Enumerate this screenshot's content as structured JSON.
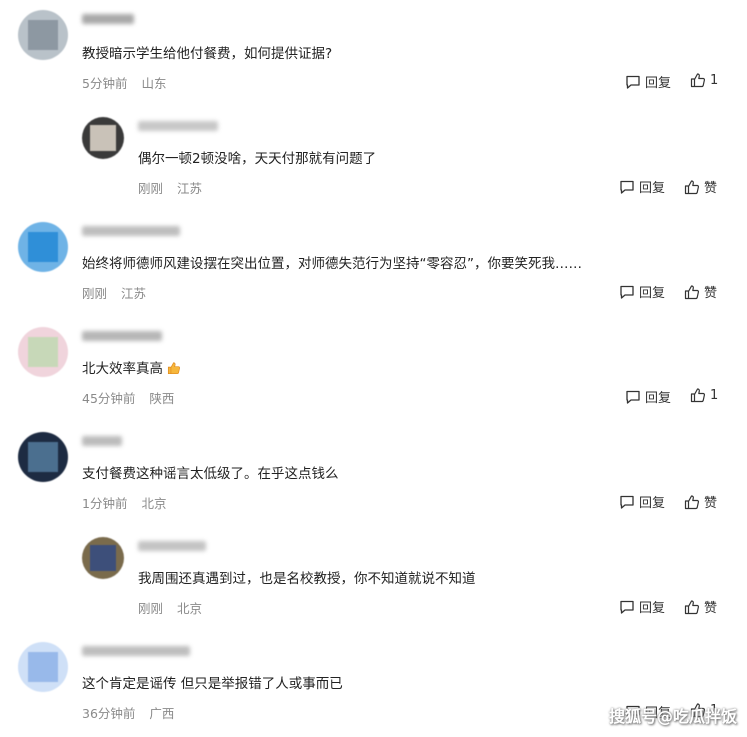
{
  "comments": [
    {
      "text": "教授暗示学生给他付餐费，如何提供证据?",
      "time": "5分钟前",
      "location": "山东",
      "reply_label": "回复",
      "like_label": "1"
    },
    {
      "text": "偶尔一顿2顿没啥，天天付那就有问题了",
      "time": "刚刚",
      "location": "江苏",
      "reply_label": "回复",
      "like_label": "赞"
    },
    {
      "text": "始终将师德师风建设摆在突出位置，对师德失范行为坚持“零容忍”，你要笑死我……",
      "time": "刚刚",
      "location": "江苏",
      "reply_label": "回复",
      "like_label": "赞"
    },
    {
      "text": "北大效率真高",
      "time": "45分钟前",
      "location": "陕西",
      "reply_label": "回复",
      "like_label": "1"
    },
    {
      "text": "支付餐费这种谣言太低级了。在乎这点钱么",
      "time": "1分钟前",
      "location": "北京",
      "reply_label": "回复",
      "like_label": "赞"
    },
    {
      "text": "我周围还真遇到过，也是名校教授，你不知道就说不知道",
      "time": "刚刚",
      "location": "北京",
      "reply_label": "回复",
      "like_label": "赞"
    },
    {
      "text": "这个肯定是谣传 但只是举报错了人或事而已",
      "time": "36分钟前",
      "location": "广西",
      "reply_label": "回复",
      "like_label": "1"
    }
  ],
  "emoji_icon": "thumbs-up-emoji",
  "watermark": "搜狐号@吃瓜拌饭",
  "icons": {
    "reply": "comment-bubble-icon",
    "like": "thumbs-up-icon"
  }
}
